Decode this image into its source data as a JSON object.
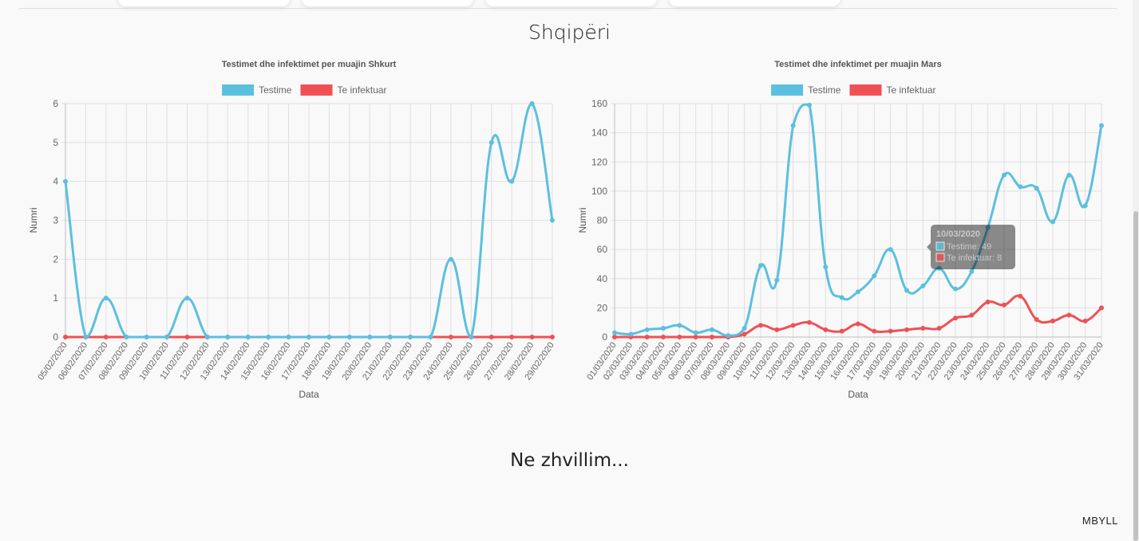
{
  "page": {
    "title": "Shqipëri",
    "in_development": "Ne zhvillim...",
    "close_label": "MBYLL"
  },
  "colors": {
    "testime": "#5bc0de",
    "te_infektuar": "#f05054",
    "grid": "#e0e0e0"
  },
  "chart_data": [
    {
      "type": "line",
      "title": "Testimet dhe infektimet per muajin Shkurt",
      "xlabel": "Data",
      "ylabel": "Numri",
      "ylim": [
        0,
        6
      ],
      "yticks": [
        0,
        1,
        2,
        3,
        4,
        5,
        6
      ],
      "grid": true,
      "legend": "top-center",
      "categories": [
        "05/02/2020",
        "06/02/2020",
        "07/02/2020",
        "08/02/2020",
        "09/02/2020",
        "10/02/2020",
        "11/02/2020",
        "12/02/2020",
        "13/02/2020",
        "14/02/2020",
        "15/02/2020",
        "16/02/2020",
        "17/02/2020",
        "18/02/2020",
        "19/02/2020",
        "20/02/2020",
        "21/02/2020",
        "22/02/2020",
        "23/02/2020",
        "24/02/2020",
        "25/02/2020",
        "26/02/2020",
        "27/02/2020",
        "28/02/2020",
        "29/02/2020"
      ],
      "series": [
        {
          "name": "Testime",
          "values": [
            4,
            0,
            1,
            0,
            0,
            0,
            1,
            0,
            0,
            0,
            0,
            0,
            0,
            0,
            0,
            0,
            0,
            0,
            0,
            2,
            0,
            5,
            4,
            6,
            3
          ]
        },
        {
          "name": "Te infektuar",
          "values": [
            0,
            0,
            0,
            0,
            0,
            0,
            0,
            0,
            0,
            0,
            0,
            0,
            0,
            0,
            0,
            0,
            0,
            0,
            0,
            0,
            0,
            0,
            0,
            0,
            0
          ]
        }
      ]
    },
    {
      "type": "line",
      "title": "Testimet dhe infektimet per muajin Mars",
      "xlabel": "Data",
      "ylabel": "Numri",
      "ylim": [
        0,
        160
      ],
      "yticks": [
        0,
        20,
        40,
        60,
        80,
        100,
        120,
        140,
        160
      ],
      "grid": true,
      "legend": "top-center",
      "categories": [
        "01/03/2020",
        "02/03/2020",
        "03/03/2020",
        "04/03/2020",
        "05/03/2020",
        "06/03/2020",
        "07/03/2020",
        "08/03/2020",
        "09/03/2020",
        "10/03/2020",
        "11/03/2020",
        "12/03/2020",
        "13/03/2020",
        "14/03/2020",
        "15/03/2020",
        "16/03/2020",
        "17/03/2020",
        "18/03/2020",
        "19/03/2020",
        "20/03/2020",
        "21/03/2020",
        "22/03/2020",
        "23/03/2020",
        "24/03/2020",
        "25/03/2020",
        "26/03/2020",
        "27/03/2020",
        "28/03/2020",
        "29/03/2020",
        "30/03/2020",
        "31/03/2020"
      ],
      "series": [
        {
          "name": "Testime",
          "values": [
            3,
            2,
            5,
            6,
            8,
            3,
            5,
            1,
            6,
            49,
            39,
            145,
            159,
            48,
            27,
            31,
            42,
            60,
            32,
            35,
            47,
            33,
            45,
            75,
            111,
            103,
            102,
            79,
            111,
            90,
            145
          ]
        },
        {
          "name": "Te infektuar",
          "values": [
            0,
            0,
            0,
            0,
            0,
            0,
            0,
            0,
            2,
            8,
            5,
            8,
            10,
            5,
            4,
            9,
            4,
            4,
            5,
            6,
            6,
            13,
            15,
            24,
            22,
            28,
            12,
            11,
            15,
            11,
            20
          ]
        }
      ],
      "tooltip": {
        "title": "10/03/2020",
        "lines": [
          "Testime: 49",
          "Te infektuar: 8"
        ],
        "index": 9
      }
    }
  ]
}
